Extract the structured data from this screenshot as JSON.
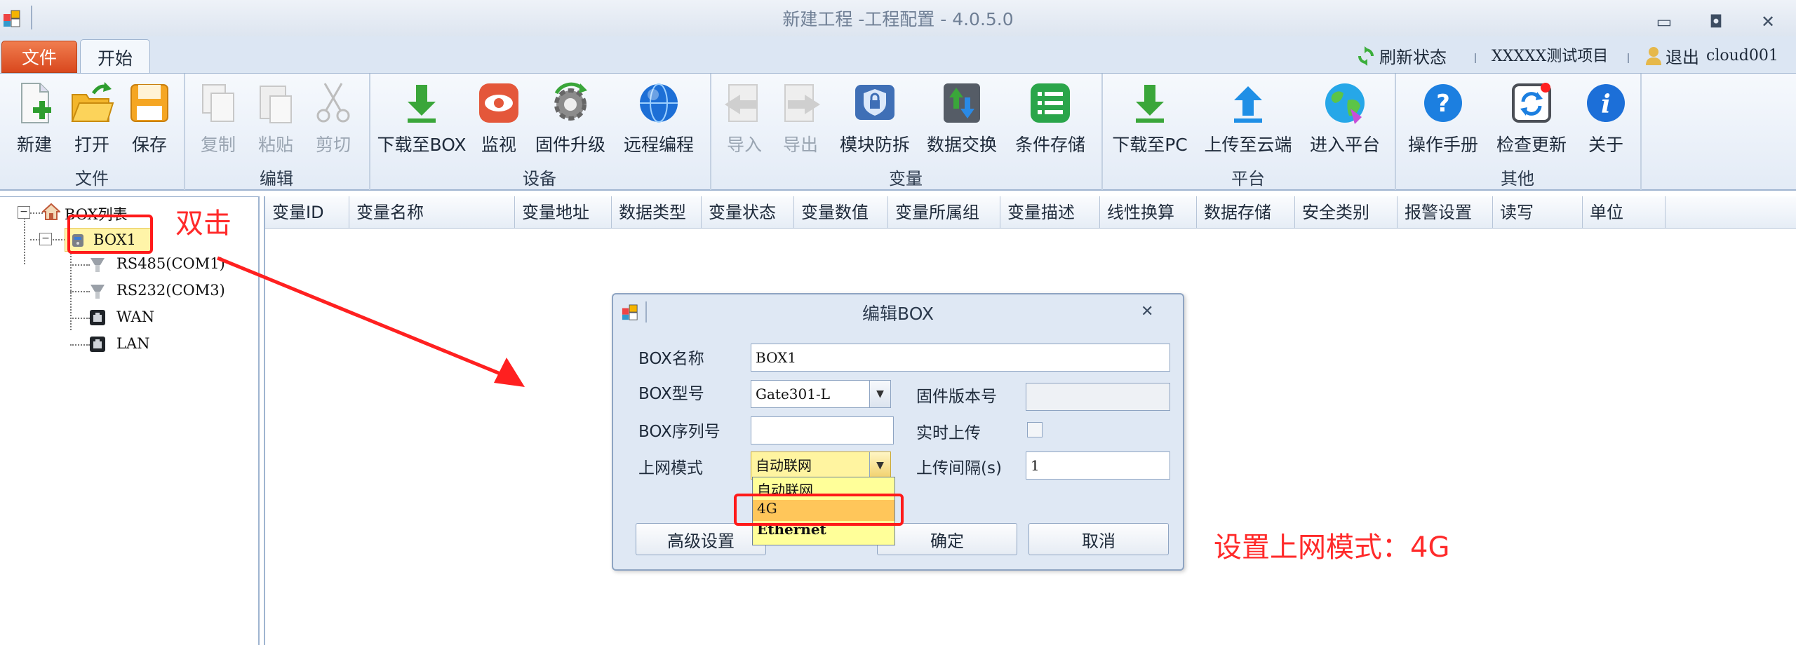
{
  "window": {
    "title": "新建工程 -工程配置 - 4.0.5.0",
    "controls": {
      "minimize": "▭",
      "restore": "◘",
      "close": "✕"
    }
  },
  "tabs": {
    "file": "文件",
    "start": "开始"
  },
  "topbar": {
    "refresh": "刷新状态",
    "project": "XXXXX测试项目",
    "logout": "退出",
    "user": "cloud001"
  },
  "ribbon": {
    "groups": {
      "file": "文件",
      "edit": "编辑",
      "device": "设备",
      "variable": "变量",
      "platform": "平台",
      "other": "其他"
    },
    "buttons": {
      "new": "新建",
      "open": "打开",
      "save": "保存",
      "copy": "复制",
      "paste": "粘贴",
      "cut": "剪切",
      "download_box": "下载至BOX",
      "monitor": "监视",
      "firmware": "固件升级",
      "remote": "远程编程",
      "import": "导入",
      "export": "导出",
      "tamper": "模块防拆",
      "exchange": "数据交换",
      "cond_store": "条件存储",
      "download_pc": "下载至PC",
      "upload_cloud": "上传至云端",
      "enter_platform": "进入平台",
      "manual": "操作手册",
      "check_update": "检查更新",
      "about": "关于"
    }
  },
  "tree": {
    "root": "BOX列表",
    "box": "BOX1",
    "children": [
      "RS485(COM1)",
      "RS232(COM3)",
      "WAN",
      "LAN"
    ]
  },
  "grid": {
    "columns": [
      "变量ID",
      "变量名称",
      "变量地址",
      "数据类型",
      "变量状态",
      "变量数值",
      "变量所属组",
      "变量描述",
      "线性换算",
      "数据存储",
      "安全类别",
      "报警设置",
      "读写",
      "单位"
    ]
  },
  "dialog": {
    "title": "编辑BOX",
    "close": "✕",
    "labels": {
      "name": "BOX名称",
      "model": "BOX型号",
      "serial": "BOX序列号",
      "net_mode": "上网模式",
      "fw_version": "固件版本号",
      "realtime": "实时上传",
      "interval": "上传间隔(s)"
    },
    "values": {
      "name": "BOX1",
      "model": "Gate301-L",
      "serial": "",
      "net_mode": "自动联网",
      "fw_version": "",
      "interval": "1"
    },
    "dropdown_options": [
      "自动联网",
      "4G",
      "Ethernet"
    ],
    "dropdown_highlighted": "4G",
    "buttons": {
      "advanced": "高级设置",
      "ok": "确定",
      "cancel": "取消"
    }
  },
  "annotations": {
    "double_click": "双击",
    "set_mode": "设置上网模式：4G"
  },
  "colors": {
    "annotation_red": "#ff1a1a",
    "file_tab": "#e2572a",
    "dropdown_bg": "#ffff99",
    "dropdown_highlight": "#ffc65a"
  }
}
